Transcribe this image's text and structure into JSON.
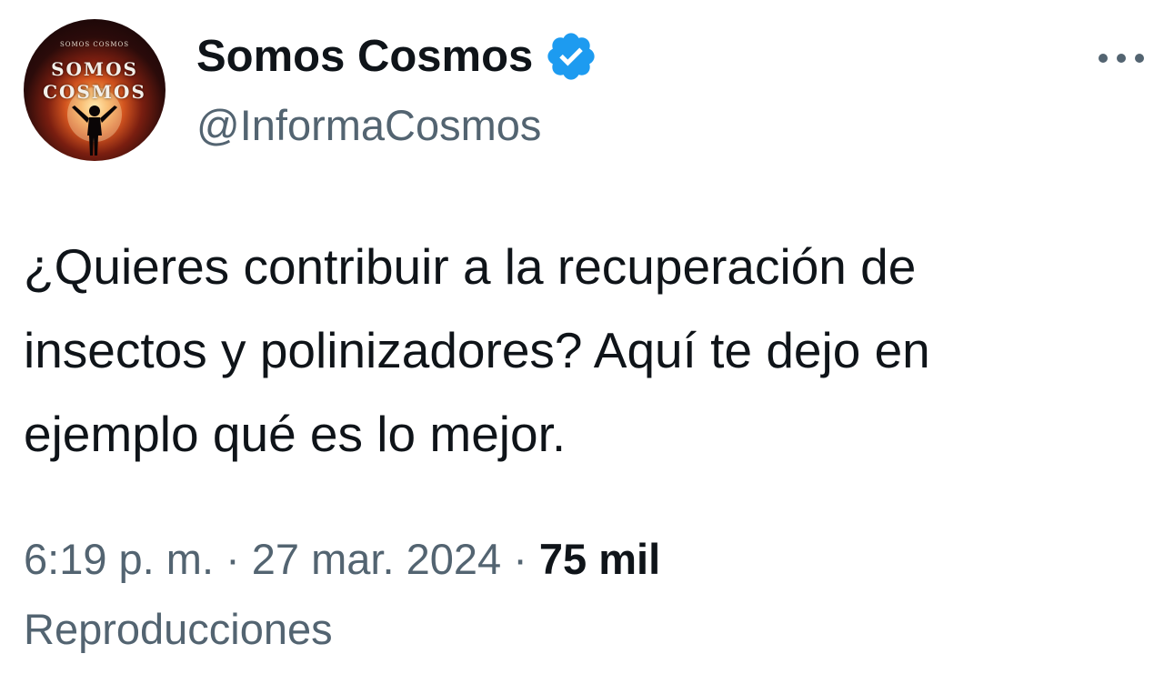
{
  "author": {
    "display_name": "Somos Cosmos",
    "handle": "@InformaCosmos",
    "verified": true,
    "avatar": {
      "line1": "SOMOS",
      "line2": "COSMOS",
      "tiny": "SOMOS COSMOS"
    }
  },
  "more_icon": "more-horizontal-icon",
  "verified_icon": "verified-badge-icon",
  "colors": {
    "text_primary": "#0f1419",
    "text_secondary": "#536471",
    "verified_blue": "#1d9bf0"
  },
  "tweet": {
    "text": "¿Quieres contribuir a la recuperación de\ninsectos y polinizadores? Aquí te dejo en\nejemplo qué es lo mejor."
  },
  "meta": {
    "time": "6:19 p. m.",
    "separator": "·",
    "date": "27 mar. 2024",
    "views_count": "75 mil",
    "views_label": "Reproducciones"
  }
}
